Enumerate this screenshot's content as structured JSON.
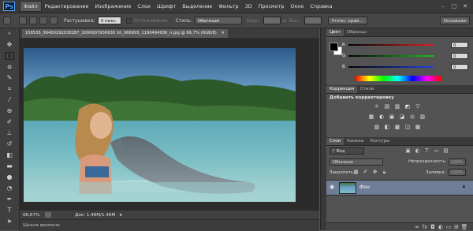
{
  "app": {
    "logo": "Ps",
    "menu": [
      "Файл",
      "Редактирование",
      "Изображение",
      "Слои",
      "Шрифт",
      "Выделение",
      "Фильтр",
      "3D",
      "Просмотр",
      "Окно",
      "Справка"
    ],
    "active_menu_index": 0,
    "window_controls": [
      "–",
      "□",
      "✕"
    ]
  },
  "options_bar": {
    "feather_label": "Растушевка:",
    "feather_value": "0 пикс.",
    "antialias_label": "Сглаживание",
    "style_label": "Стиль:",
    "style_value": "Обычный",
    "width_label": "Шир.:",
    "height_label": "Выс.:",
    "refine_button": "Уточн. край...",
    "workspace": "Основная"
  },
  "document": {
    "tab_title": "156535_36400292030287_1000007930638 10_966995_1190464936_n.jpg @ 66,7% (RGB/8)",
    "zoom": "66,67%",
    "doc_info": "Док: 1,48M/1,48M",
    "timeline_label": "Шкала времени"
  },
  "color_panel": {
    "tabs": [
      "Цвет",
      "Образцы"
    ],
    "active_tab": 0,
    "channels": [
      {
        "label": "R",
        "value": "0",
        "color": "#e02020"
      },
      {
        "label": "G",
        "value": "0",
        "color": "#20c020"
      },
      {
        "label": "B",
        "value": "0",
        "color": "#2040e0"
      }
    ],
    "foreground": "#000000",
    "background": "#ffffff"
  },
  "adjustments_panel": {
    "tabs": [
      "Коррекция",
      "Стили"
    ],
    "active_tab": 0,
    "title": "Добавить корректировку",
    "row1_icons": [
      "☼",
      "▤",
      "▧",
      "◩",
      "▽"
    ],
    "row2_icons": [
      "▦",
      "◐",
      "▣",
      "◪",
      "◎",
      "▥"
    ],
    "row3_icons": [
      "▨",
      "◧",
      "▩",
      "◫",
      "▦"
    ]
  },
  "layers_panel": {
    "tabs": [
      "Слои",
      "Каналы",
      "Контуры"
    ],
    "active_tab": 0,
    "filter_label": "Вид",
    "blend_mode": "Обычные",
    "opacity_label": "Непрозрачность:",
    "opacity_value": "100%",
    "lock_label": "Закрепить:",
    "fill_label": "Заливка:",
    "fill_value": "100%",
    "layers": [
      {
        "name": "Фон",
        "visible": true,
        "locked": true
      }
    ]
  }
}
